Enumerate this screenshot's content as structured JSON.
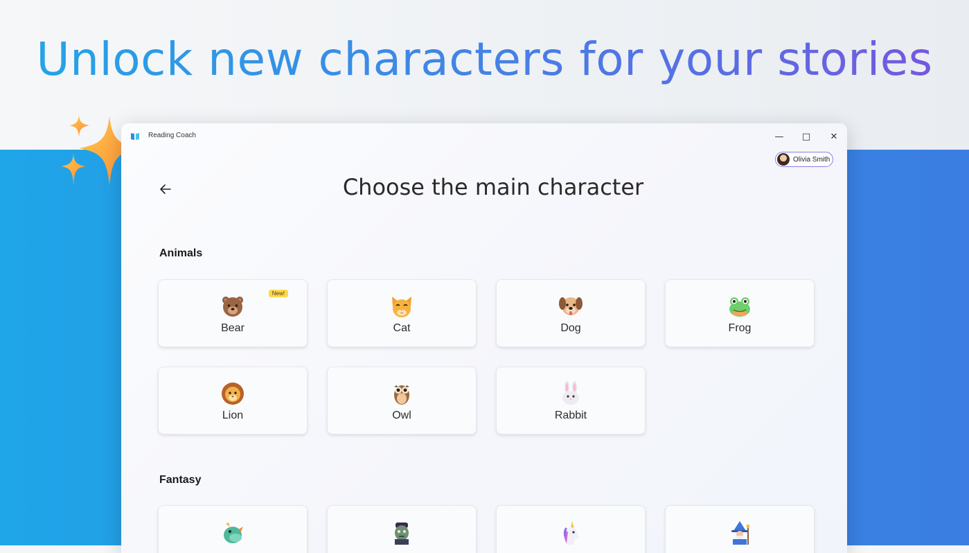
{
  "headline": "Unlock new characters for your stories",
  "window": {
    "app_title": "Reading Coach",
    "minimize_glyph": "—",
    "maximize_glyph": "□",
    "close_glyph": "✕"
  },
  "user": {
    "name": "Olivia Smith"
  },
  "page": {
    "title": "Choose the main character"
  },
  "sections": {
    "animals": {
      "label": "Animals",
      "cards": [
        {
          "label": "Bear",
          "icon": "bear-icon",
          "badge": "New!"
        },
        {
          "label": "Cat",
          "icon": "cat-icon"
        },
        {
          "label": "Dog",
          "icon": "dog-icon"
        },
        {
          "label": "Frog",
          "icon": "frog-icon"
        },
        {
          "label": "Lion",
          "icon": "lion-icon"
        },
        {
          "label": "Owl",
          "icon": "owl-icon"
        },
        {
          "label": "Rabbit",
          "icon": "rabbit-icon"
        }
      ]
    },
    "fantasy": {
      "label": "Fantasy",
      "cards": [
        {
          "icon": "dragon-icon"
        },
        {
          "icon": "zombie-icon"
        },
        {
          "icon": "unicorn-icon"
        },
        {
          "icon": "wizard-icon"
        }
      ]
    }
  },
  "colors": {
    "headline_start": "#22a6e6",
    "headline_end": "#7a54df",
    "backdrop_blue": "#2f8fe4",
    "badge_yellow": "#ffd84a",
    "chip_border": "#8e7be0"
  }
}
